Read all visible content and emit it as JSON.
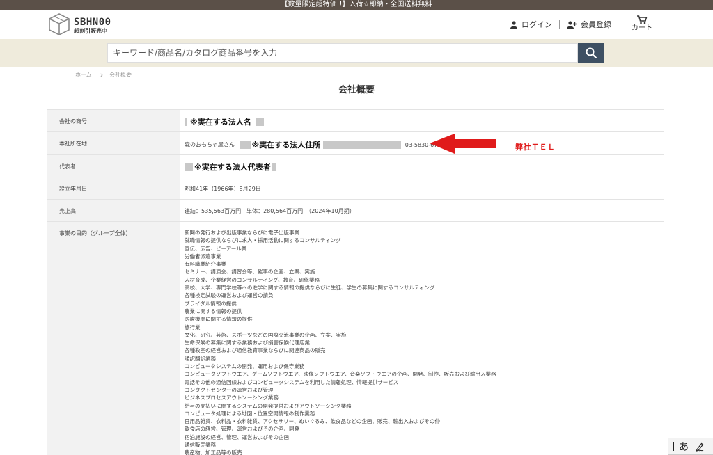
{
  "announcement": "【数量限定超特価!!】入荷☆即納・全国送料無料",
  "header": {
    "logo_main": "SBHN00",
    "logo_sub": "超割引販売中",
    "login_label": "ログイン",
    "register_label": "会員登録",
    "cart_label": "カート"
  },
  "search": {
    "placeholder": "キーワード/商品名/カタログ商品番号を入力"
  },
  "breadcrumb": {
    "home": "ホーム",
    "current": "会社概要"
  },
  "page_title": "会社概要",
  "company": {
    "name_label": "会社の商号",
    "name_value": "※実在する法人名",
    "address_label": "本社所在地",
    "address_prefix": "森のおもちゃ屋さん",
    "address_value": "※実在する法人住所",
    "address_tel": "03-5830-6771",
    "rep_label": "代表者",
    "rep_value": "※実在する法人代表者",
    "founded_label": "設立年月日",
    "founded_value": "昭和41年（1966年）8月29日",
    "sales_label": "売上高",
    "sales_value": "連結：535,563百万円　単体：280,564百万円　（2024年10月期）",
    "purpose_label": "事業の目的（グループ全体）",
    "purpose_items": [
      "新聞の発行および出版事業ならびに電子出版事業",
      "就職情報の提供ならびに求人・採用活動に関するコンサルティング",
      "宣伝、広告、ピーアール業",
      "労働者派遣事業",
      "有料職業紹介事業",
      "セミナー、講演会、講習会等、催事の企画、立案、実施",
      "人材育成、企業経営のコンサルティング、教育、研修業務",
      "高校、大学、専門学校等への進学に関する情報の提供ならびに生徒、学生の募集に関するコンサルティング",
      "各種検定試験の運営および運営の請負",
      "ブライダル情報の提供",
      "農業に関する情報の提供",
      "医療機関に関する情報の提供",
      "旅行業",
      "文化、研究、芸術、スポーツなどの国際交流事業の企画、立案、実施",
      "生命保険の募集に関する業務および損害保険代理店業",
      "各種教室の経営および通信教育事業ならびに関連商品の販売",
      "通訳翻訳業務",
      "コンピュータシステムの開発、運用および保守業務",
      "コンピュータソフトウエア、ゲームソフトウエア、映像ソフトウエア、音楽ソフトウエアの企画、開発、制作、販売および輸出入業務",
      "電話その他の通信回線およびコンピュータシステムを利用した情報処理、情報提供サービス",
      "コンタクトセンターの運営および管理",
      "ビジネスプロセスアウトソーシング業務",
      "給与の支払いに関するシステムの開発提供およびアウトソーシング業務",
      "コンピュータ処理による地図・位置空間情報の制作業務",
      "日用品雑貨、衣料品・衣料雑貨、アクセサリー、ぬいぐるみ、飲食品などの企画、販売、輸出入およびその仲",
      "飲食店の経営、管理、運営およびその企画、開発",
      "宿泊施設の経営、管理、運営およびその企画",
      "通信販売業務",
      "農産物、加工品等の販売"
    ]
  },
  "annotation": "弊社ＴＥＬ",
  "ime": {
    "mode": "あ"
  },
  "colors": {
    "topbar": "#5b5048",
    "search_band": "#efebdc",
    "search_button": "#3e5063",
    "label_cell": "#f2f2f2",
    "redaction": "#c8c8c8",
    "annotation_red": "#e01b1b"
  },
  "icons": {
    "logo": "cube-logo-icon",
    "login": "person-icon",
    "register": "person-add-icon",
    "cart": "cart-icon",
    "search": "search-icon",
    "arrow": "arrow-left-icon",
    "ime_pen": "pen-icon"
  }
}
